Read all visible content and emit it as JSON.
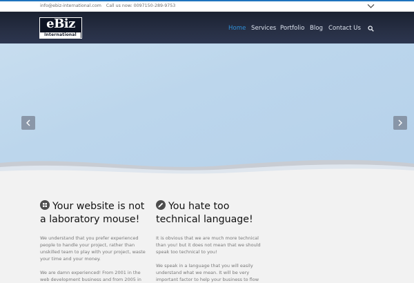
{
  "topbar": {
    "email": "info@ebiz-international.com",
    "phone": "Call us now: 0097150-289-9753",
    "dropdown_icon": "chevron-down-icon"
  },
  "header": {
    "logo_main": "eBiz",
    "logo_sub": "International",
    "nav": [
      "Home",
      "Services",
      "Portfolio",
      "Blog",
      "Contact Us"
    ],
    "active_nav": "Home",
    "search_icon": "search-icon"
  },
  "slider": {
    "prev_icon": "chevron-left-icon",
    "next_icon": "chevron-right-icon"
  },
  "features": [
    {
      "icon": "grid-icon",
      "title": "Your website is not a laboratory mouse!",
      "p1": "We understand that you prefer experienced people to handle your project, rather than unskilled team to play with your project, waste your time and your money.",
      "p2": "We are damn experienced! From 2001 in the web development business and from 2005 in"
    },
    {
      "icon": "pencil-icon",
      "title": "You hate too technical language!",
      "p1": "It is obvious that we are much more technical than you! but it does not mean that we should speak too technical to you!",
      "p2": "We speak in a language that you will easily understand what we mean. It will be very important factor to help your business to flow"
    }
  ],
  "colors": {
    "accent": "#2f8fd8",
    "header_bg": "#232a3c",
    "slider_bg": "#bcd6ec"
  }
}
